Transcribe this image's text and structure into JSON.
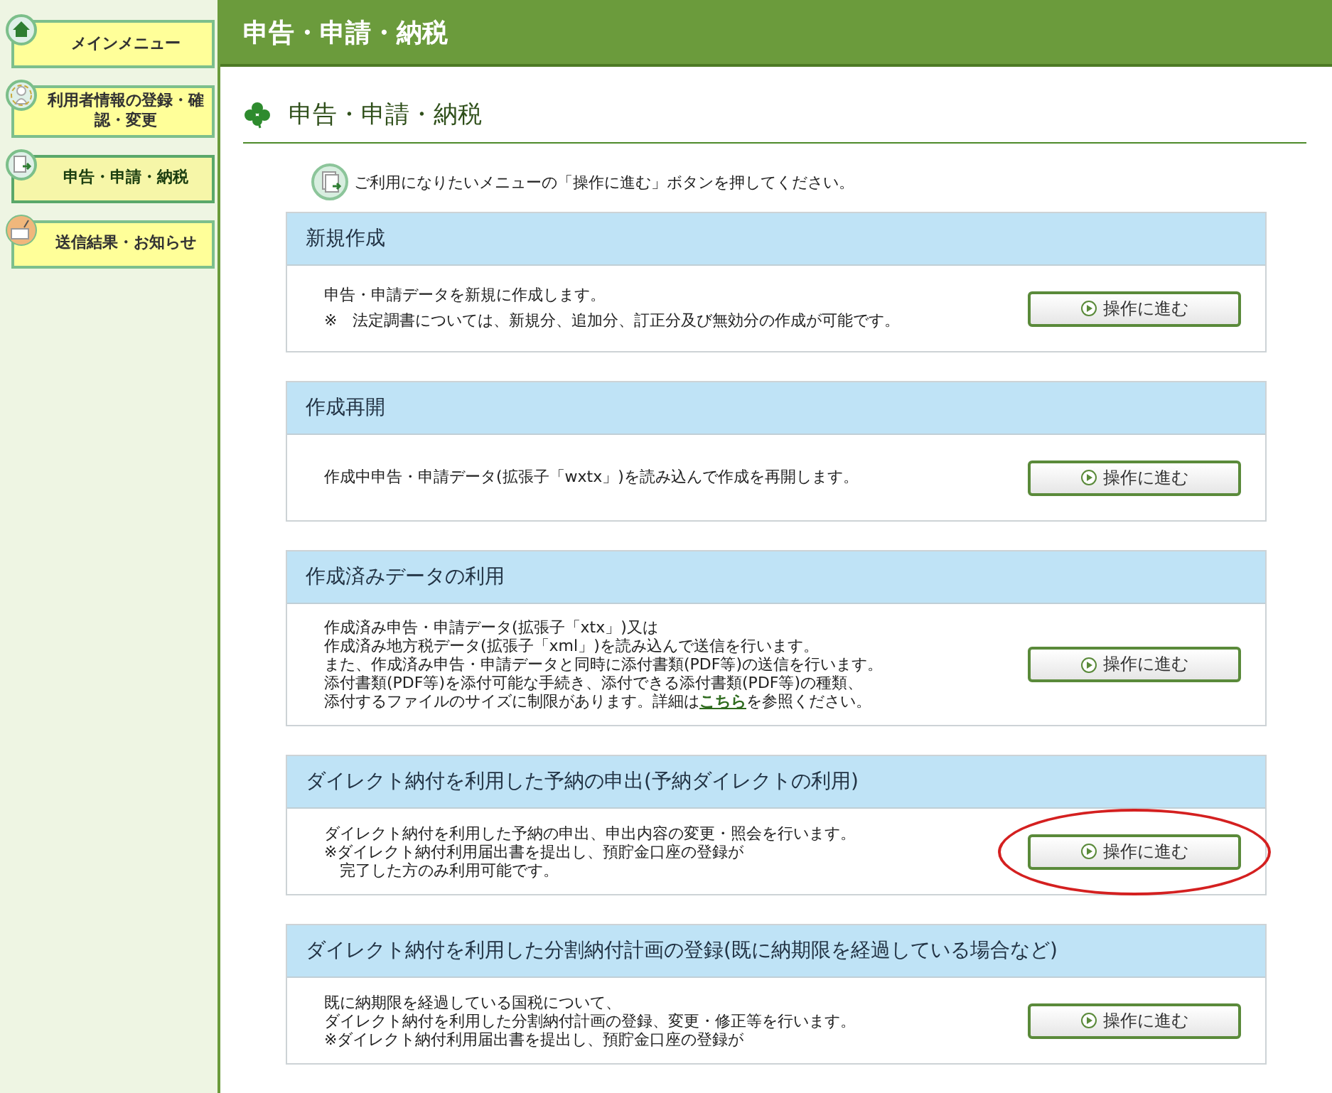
{
  "sidebar": {
    "items": [
      {
        "label": "メインメニュー",
        "selected": false
      },
      {
        "label": "利用者情報の登録・確認・変更",
        "selected": false
      },
      {
        "label": "申告・申請・納税",
        "selected": true
      },
      {
        "label": "送信結果・お知らせ",
        "selected": false
      }
    ]
  },
  "header": {
    "title": "申告・申請・納税"
  },
  "page_title": "申告・申請・納税",
  "instruction": "ご利用になりたいメニューの「操作に進む」ボタンを押してください。",
  "sections": [
    {
      "title": "新規作成",
      "lines": [
        "申告・申請データを新規に作成します。",
        "※　法定調書については、新規分、追加分、訂正分及び無効分の作成が可能です。"
      ],
      "button": "操作に進む",
      "highlighted": false
    },
    {
      "title": "作成再開",
      "lines": [
        "作成中申告・申請データ(拡張子「wxtx」)を読み込んで作成を再開します。"
      ],
      "button": "操作に進む",
      "highlighted": false
    },
    {
      "title": "作成済みデータの利用",
      "lines": [
        "作成済み申告・申請データ(拡張子「xtx」)又は",
        "作成済み地方税データ(拡張子「xml」)を読み込んで送信を行います。",
        "また、作成済み申告・申請データと同時に添付書類(PDF等)の送信を行います。",
        "添付書類(PDF等)を添付可能な手続き、添付できる添付書類(PDF等)の種類、",
        "添付するファイルのサイズに制限があります。詳細は"
      ],
      "link": "こちら",
      "after_link": "を参照ください。",
      "button": "操作に進む",
      "highlighted": false
    },
    {
      "title": "ダイレクト納付を利用した予納の申出(予納ダイレクトの利用)",
      "lines": [
        "ダイレクト納付を利用した予納の申出、申出内容の変更・照会を行います。",
        "※ダイレクト納付利用届出書を提出し、預貯金口座の登録が",
        "　完了した方のみ利用可能です。"
      ],
      "button": "操作に進む",
      "highlighted": true
    },
    {
      "title": "ダイレクト納付を利用した分割納付計画の登録(既に納期限を経過している場合など)",
      "lines": [
        "既に納期限を経過している国税について、",
        "ダイレクト納付を利用した分割納付計画の登録、変更・修正等を行います。",
        "※ダイレクト納付利用届出書を提出し、預貯金口座の登録が"
      ],
      "button": "操作に進む",
      "highlighted": false
    }
  ]
}
